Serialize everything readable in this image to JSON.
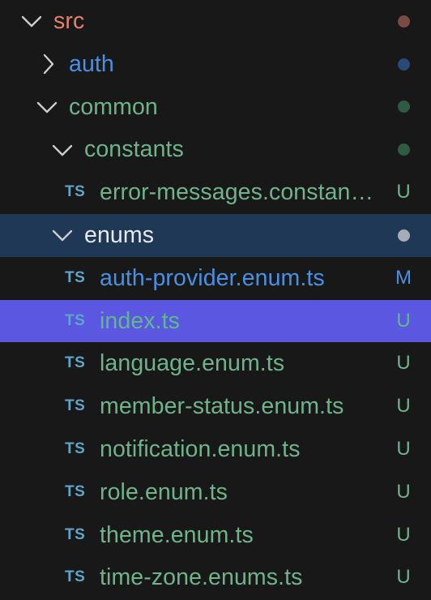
{
  "colors": {
    "background": "#181818",
    "focused_row": "#1f3855",
    "selected_row": "#5b57e0",
    "chevron": "#cccccc",
    "folder_untracked": "#6fb38a",
    "folder_src": "#e0806d",
    "folder_modified": "#4a90e2",
    "file_untracked": "#6fb38a",
    "file_modified": "#4a90e2",
    "ts_icon": "#5ea5c8",
    "dot_src": "#7a4a43",
    "dot_modified": "#274a78",
    "dot_untracked": "#2f5a44",
    "dot_focused": "#a7acb6",
    "label_focused": "#e7eaee",
    "selected_text": "#5fb98d"
  },
  "explorer": {
    "rows": [
      {
        "type": "folder",
        "expanded": true,
        "label": "src",
        "status": "dot",
        "icon": "chevron-down-icon"
      },
      {
        "type": "folder",
        "expanded": false,
        "label": "auth",
        "status": "dot",
        "icon": "chevron-right-icon"
      },
      {
        "type": "folder",
        "expanded": true,
        "label": "common",
        "status": "dot",
        "icon": "chevron-down-icon"
      },
      {
        "type": "folder",
        "expanded": true,
        "label": "constants",
        "status": "dot",
        "icon": "chevron-down-icon"
      },
      {
        "type": "file",
        "icon_text": "TS",
        "label": "error-messages.constants.ts",
        "status": "U"
      },
      {
        "type": "folder",
        "expanded": true,
        "label": "enums",
        "status": "dot",
        "icon": "chevron-down-icon",
        "focused": true
      },
      {
        "type": "file",
        "icon_text": "TS",
        "label": "auth-provider.enum.ts",
        "status": "M"
      },
      {
        "type": "file",
        "icon_text": "TS",
        "label": "index.ts",
        "status": "U",
        "selected": true
      },
      {
        "type": "file",
        "icon_text": "TS",
        "label": "language.enum.ts",
        "status": "U"
      },
      {
        "type": "file",
        "icon_text": "TS",
        "label": "member-status.enum.ts",
        "status": "U"
      },
      {
        "type": "file",
        "icon_text": "TS",
        "label": "notification.enum.ts",
        "status": "U"
      },
      {
        "type": "file",
        "icon_text": "TS",
        "label": "role.enum.ts",
        "status": "U"
      },
      {
        "type": "file",
        "icon_text": "TS",
        "label": "theme.enum.ts",
        "status": "U"
      },
      {
        "type": "file",
        "icon_text": "TS",
        "label": "time-zone.enums.ts",
        "status": "U"
      }
    ]
  }
}
